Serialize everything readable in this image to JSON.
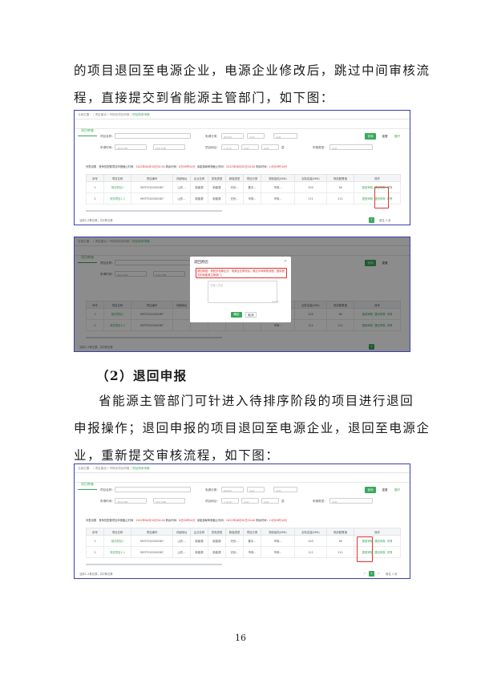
{
  "intro": {
    "line1": "的项目退回至电源企业，电源企业修改后，跳过中间审核流",
    "line2": "程，直接提交到省能源主管部门，如下图："
  },
  "section_heading": "（2）退回申报",
  "para2": {
    "line1": "省能源主管部门可针进入待排序阶段的项目进行退回",
    "line2": "申报操作；退回申报的项目退回至电源企业，退回至电源企",
    "line3": "业，重新提交审核流程，如下图："
  },
  "page_number": "16",
  "ui": {
    "breadcrumb": {
      "home": "当前位置：",
      "level1": "项目建设",
      "level2": "市场化项目申报",
      "level3": "项目排序申报"
    },
    "tab_label": "项目审查",
    "form": {
      "project_name_label": "项目名称：",
      "power_type_label": "电源分类：",
      "power_type_value": "新能源",
      "power_type_select1": "全部",
      "power_type_select2": "全部",
      "apply_time_label": "申请时间：",
      "start_date_placeholder": "开始日期",
      "end_date_placeholder": "结束日期",
      "location_label": "项目地址：",
      "location_value": "山东省",
      "location_select1": "全部",
      "location_select2": "全部",
      "location_select3": "县",
      "apply_type_label": "申报类型：",
      "apply_type_value": "全部"
    },
    "buttons": {
      "search": "查询",
      "reset": "重置",
      "expand": "展开"
    },
    "deadline": {
      "prefix": "竞争性配置项目申报截止时间：",
      "date1": "2022年06月30日20:00",
      "remain1_label": "剩余时间：",
      "remain1": "6日09时44分",
      "prefix2": "省能源局审核截止时间：",
      "date2": "2022年06月30日20:00",
      "remain2_label": "剩余时间：",
      "remain2": "14日09时44分"
    },
    "list_title": "列表设置",
    "table": {
      "headers": [
        "序号",
        "项目名称",
        "项目编号",
        "详细地址",
        "企业名称",
        "发电类型",
        "新能类型",
        "项目分类",
        "规划装机(MW)",
        "实际容量(MW)",
        "规划配置值",
        "操作"
      ],
      "rows": [
        [
          "1",
          "测试项目1",
          "MGTF202200087",
          "山东...",
          "新能源",
          "新能源",
          "光伏...",
          "集中...",
          "市场...",
          "100",
          "36",
          ""
        ],
        [
          "2",
          "测试项目1-1",
          "MGTF202200087",
          "山东...",
          "新能源",
          "新能源",
          "光伏...",
          "市场...",
          "市场...",
          "111",
          "111",
          ""
        ]
      ],
      "ops": [
        "退回审核",
        "退回申报",
        "详情"
      ]
    },
    "total": "当前1-2条记录，共2条记录",
    "pagination": {
      "current": "1",
      "prev": "<",
      "next": ">",
      "goto_label": "前往",
      "goto_value": "1",
      "page_unit": "页"
    },
    "modal": {
      "title": "退回原因",
      "close": "×",
      "note": "退回原因：退回至电源企业、电源企业修改后，跳过中间审核流程，直接提交到省能源主管部门。",
      "placeholder": "请输入内容",
      "counter": "0/200",
      "ok": "确定",
      "cancel": "取消"
    }
  },
  "colors": {
    "frame_border": "#3a3fb0",
    "accent_green": "#3aa75b",
    "highlight_red": "#e03333"
  }
}
